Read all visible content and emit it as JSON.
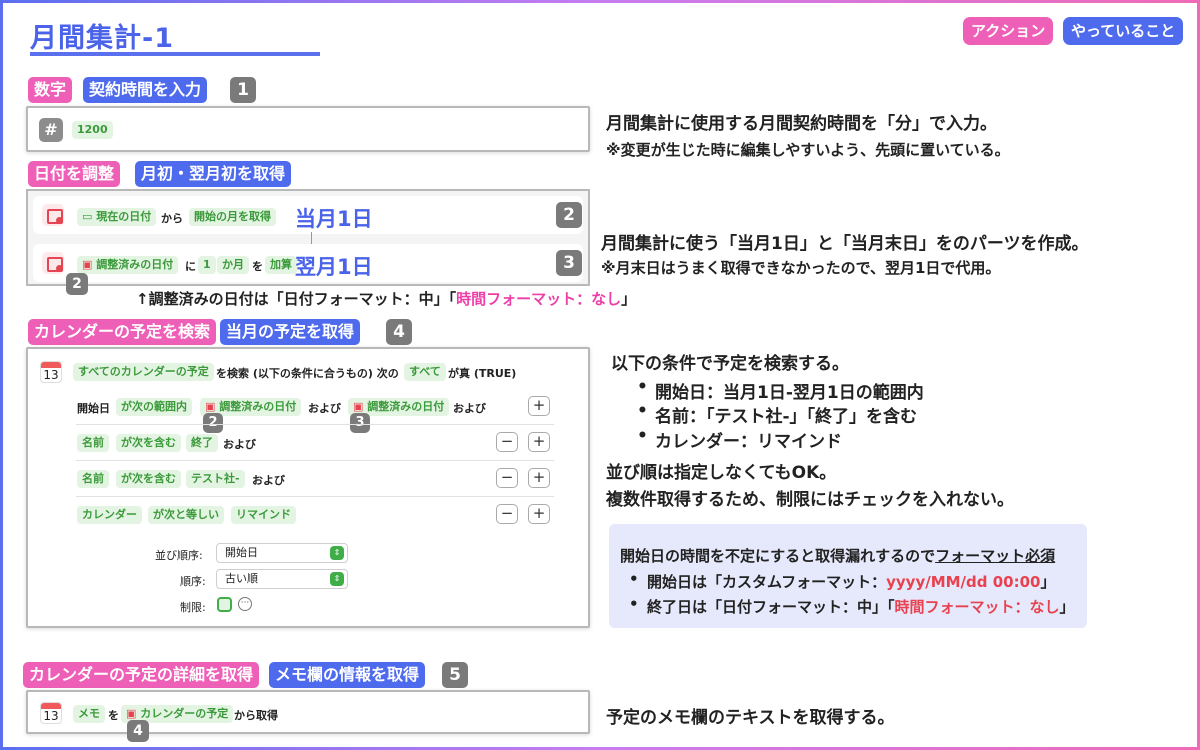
{
  "title": "月間集計-1",
  "legend": {
    "action": "アクション",
    "doing": "やっていること"
  },
  "section1": {
    "tag_action": "数字",
    "tag_doing": "契約時間を入力",
    "num": "1",
    "value": "1200",
    "desc1": "月間集計に使用する月間契約時間を「分」で入力。",
    "desc2": "※変更が生じた時に編集しやすいよう、先頭に置いている。"
  },
  "section2": {
    "tag_action": "日付を調整",
    "tag_doing": "月初・翌月初を取得",
    "row1": {
      "p1": "現在の日付",
      "t1": "から",
      "p2": "開始の月を取得",
      "label": "当月1日",
      "num": "2"
    },
    "row2": {
      "p1": "調整済みの日付",
      "t1": "に",
      "p2": "1",
      "p3": "か月",
      "t2": "を",
      "p4": "加算",
      "label": "翌月1日",
      "num": "3",
      "badge": "2"
    },
    "desc1": "月間集計に使う「当月1日」と「当月末日」をのパーツを作成。",
    "desc2": "※月末日はうまく取得できなかったので、翌月1日で代用。",
    "note_prefix": "↑調整済みの日付は「日付フォーマット：中」「",
    "note_highlight": "時間フォーマット：なし",
    "note_suffix": "」"
  },
  "section3": {
    "tag_action": "カレンダーの予定を検索",
    "tag_doing": "当月の予定を取得",
    "num": "4",
    "cal_month": "FEB",
    "cal_day": "13",
    "head": {
      "p1": "すべてのカレンダーの予定",
      "t1": "を検索 (以下の条件に合うもの) 次の",
      "p2": "すべて",
      "t2": "が真 (TRUE)"
    },
    "cond1": {
      "t1": "開始日",
      "p1": "が次の範囲内",
      "p2": "調整済みの日付",
      "t2": "および",
      "p3": "調整済みの日付",
      "t3": "および",
      "b1": "2",
      "b2": "3"
    },
    "cond2": {
      "p1": "名前",
      "p2": "が次を含む",
      "p3": "終了",
      "t1": "および"
    },
    "cond3": {
      "p1": "名前",
      "p2": "が次を含む",
      "p3": "テスト社-",
      "t1": "および"
    },
    "cond4": {
      "p1": "カレンダー",
      "p2": "が次と等しい",
      "p3": "リマインド"
    },
    "sort_label": "並び順序:",
    "sort_value": "開始日",
    "order_label": "順序:",
    "order_value": "古い順",
    "limit_label": "制限:",
    "desc_head": "以下の条件で予定を検索する。",
    "bullets": [
      "開始日：当月1日-翌月1日の範囲内",
      "名前：「テスト社-」「終了」を含む",
      "カレンダー：リマインド"
    ],
    "desc2": "並び順は指定しなくてもOK。",
    "desc3": "複数件取得するため、制限にはチェックを入れない。",
    "note": {
      "head_prefix": "開始日の時間を不定にすると取得漏れするので",
      "head_link": "フォーマット必須",
      "b1_prefix": "開始日は「カスタムフォーマット：",
      "b1_highlight": "yyyy/MM/dd 00:00",
      "b1_suffix": "」",
      "b2_prefix": "終了日は「日付フォーマット：中」「",
      "b2_highlight": "時間フォーマット：なし",
      "b2_suffix": "」"
    }
  },
  "section4": {
    "tag_action": "カレンダーの予定の詳細を取得",
    "tag_doing": "メモ欄の情報を取得",
    "num": "5",
    "cal_month": "FEB",
    "cal_day": "13",
    "p1": "メモ",
    "t1": "を",
    "p2": "カレンダーの予定",
    "t2": "から取得",
    "badge": "4",
    "desc": "予定のメモ欄のテキストを取得する。"
  },
  "colors": {
    "pink": "#ee5fb7",
    "blue": "#4f6bed",
    "green": "#3b9a3b",
    "red": "#e8414f"
  }
}
